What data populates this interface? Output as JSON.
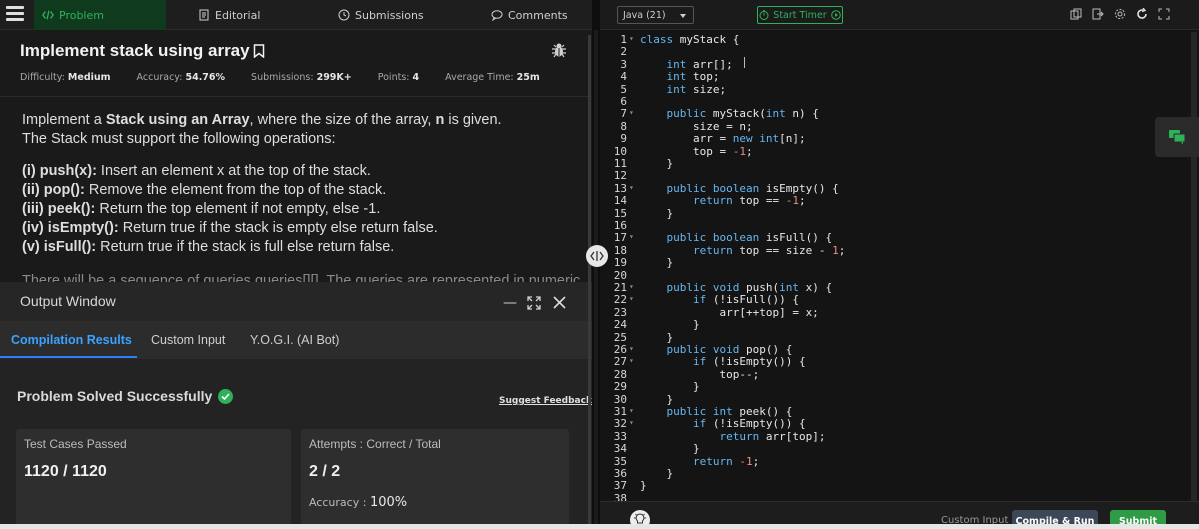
{
  "nav": {
    "tabs": [
      {
        "label": "Problem",
        "icon": "code-icon"
      },
      {
        "label": "Editorial",
        "icon": "document-icon"
      },
      {
        "label": "Submissions",
        "icon": "clock-icon"
      },
      {
        "label": "Comments",
        "icon": "comment-icon"
      }
    ]
  },
  "problem": {
    "title": "Implement stack using array",
    "meta": {
      "difficulty_label": "Difficulty:",
      "difficulty": "Medium",
      "accuracy_label": "Accuracy:",
      "accuracy": "54.76%",
      "submissions_label": "Submissions:",
      "submissions": "299K+",
      "points_label": "Points:",
      "points": "4",
      "avg_time_label": "Average Time:",
      "avg_time": "25m"
    },
    "intro_1a": "Implement a ",
    "intro_1b": "Stack using an Array",
    "intro_1c": ", where the size of the array, ",
    "intro_1d": "n",
    "intro_1e": " is given.",
    "intro_2": "The Stack must support the following operations:",
    "ops": [
      {
        "name": "(i) push(x):",
        "text": " Insert an element x at the top of the stack."
      },
      {
        "name": "(ii) pop():",
        "text": " Remove the element from the top of the stack."
      },
      {
        "name": "(iii) peek():",
        "text": " Return the top element if not empty, else -1."
      },
      {
        "name": "(iv) isEmpty():",
        "text": " Return true if the stack is empty else return false."
      },
      {
        "name": "(v) isFull():",
        "text": " Return true if the stack is full else return false."
      }
    ],
    "cut_line": "There will be a sequence of queries queries[][]. The queries are represented in numeric"
  },
  "output": {
    "title": "Output Window",
    "tabs": [
      "Compilation Results",
      "Custom Input",
      "Y.O.G.I. (AI Bot)"
    ],
    "status": "Problem Solved Successfully",
    "suggest_feedback": "Suggest Feedback",
    "test_cases_label": "Test Cases Passed",
    "test_cases_value": "1120 / 1120",
    "attempts_label": "Attempts : Correct / Total",
    "attempts_value": "2 / 2",
    "accuracy_label": "Accuracy :",
    "accuracy_value": "100%"
  },
  "editor": {
    "language": "Java (21)",
    "timer_label": "Start Timer",
    "custom_input": "Custom Input",
    "compile_run": "Compile & Run",
    "submit": "Submit",
    "code_lines": [
      "class myStack {",
      "",
      "    int arr[];",
      "    int top;",
      "    int size;",
      "",
      "    public myStack(int n) {",
      "        size = n;",
      "        arr = new int[n];",
      "        top = -1;",
      "    }",
      "",
      "    public boolean isEmpty() {",
      "        return top == -1;",
      "    }",
      "",
      "    public boolean isFull() {",
      "        return top == size - 1;",
      "    }",
      "",
      "    public void push(int x) {",
      "        if (!isFull()) {",
      "            arr[++top] = x;",
      "        }",
      "    }",
      "    public void pop() {",
      "        if (!isEmpty()) {",
      "            top--;",
      "        }",
      "    }",
      "    public int peek() {",
      "        if (!isEmpty()) {",
      "            return arr[top];",
      "        }",
      "        return -1;",
      "    }",
      "}",
      ""
    ],
    "fold_lines": [
      1,
      7,
      13,
      17,
      21,
      22,
      26,
      27,
      31,
      32
    ]
  },
  "colors": {
    "accent_green": "#2fb15a",
    "accent_blue": "#3aa3ff",
    "keyword_blue": "#66b6f0",
    "number_red": "#e88e8e"
  }
}
